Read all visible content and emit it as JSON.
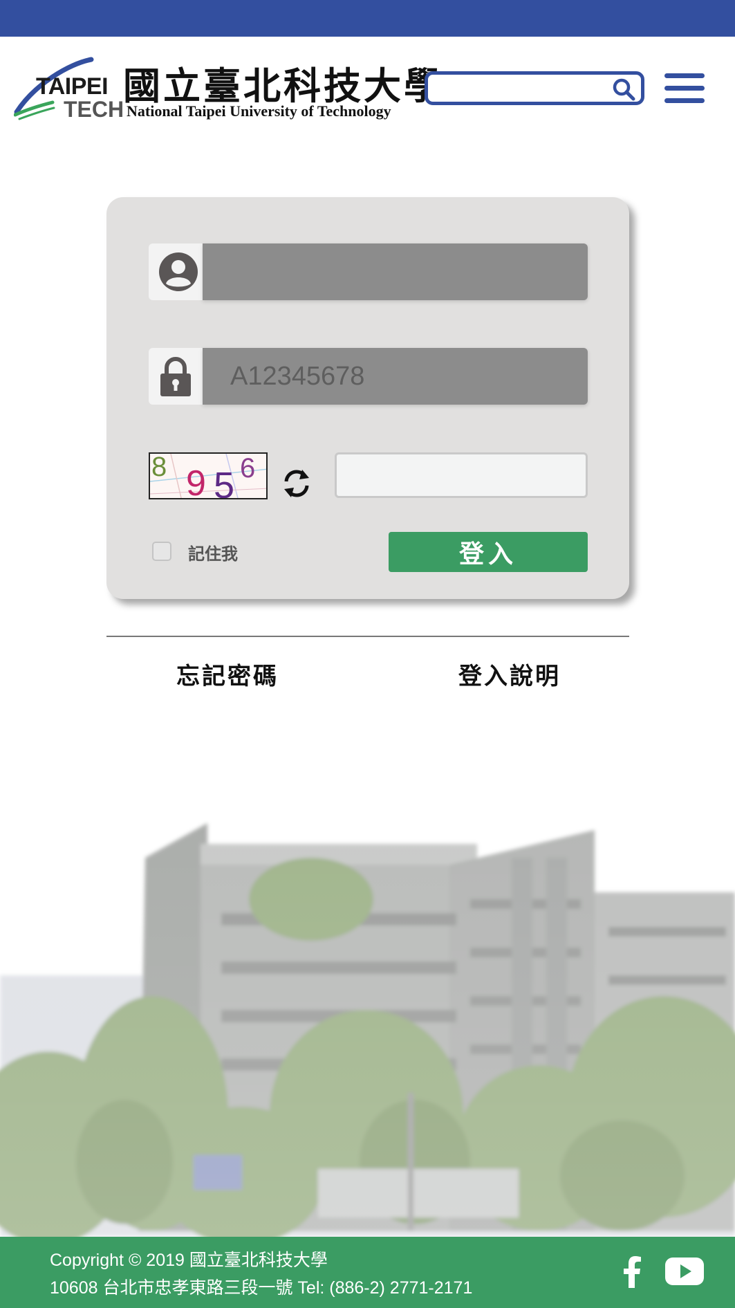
{
  "header": {
    "logo_taipei": "TAIPEI",
    "logo_tech": "TECH",
    "logo_chinese": "國立臺北科技大學",
    "logo_english": "National Taipei University of Technology",
    "search_placeholder": "",
    "brand_color": "#334f9f"
  },
  "login": {
    "username_value": "",
    "password_placeholder": "A12345678",
    "captcha_text": [
      "8",
      "9",
      "5",
      "6"
    ],
    "captcha_value": "",
    "remember_label": "記住我",
    "remember_checked": false,
    "login_label": "登入",
    "login_color": "#3b9c63"
  },
  "links": {
    "forgot_password": "忘記密碼",
    "login_help": "登入說明"
  },
  "footer": {
    "line1": "Copyright © 2019 國立臺北科技大學",
    "line2": "10608 台北市忠孝東路三段一號 Tel: (886-2) 2771-2171",
    "icons": [
      "facebook-icon",
      "youtube-icon"
    ],
    "color": "#3b9c63"
  }
}
